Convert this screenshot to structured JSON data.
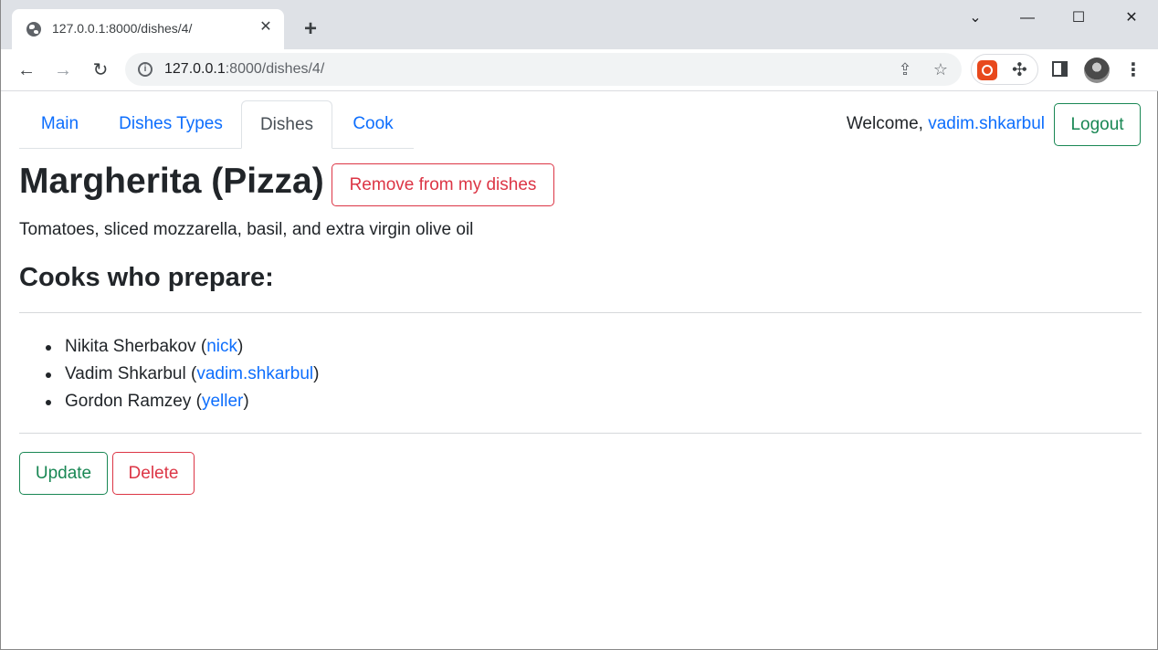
{
  "browser": {
    "tab_title": "127.0.0.1:8000/dishes/4/",
    "url_host": "127.0.0.1",
    "url_path": ":8000/dishes/4/"
  },
  "nav": {
    "tabs": [
      {
        "label": "Main"
      },
      {
        "label": "Dishes Types"
      },
      {
        "label": "Dishes"
      },
      {
        "label": "Cook"
      }
    ],
    "active_tab": "Dishes",
    "welcome_text": "Welcome,",
    "username": "vadim.shkarbul",
    "logout_label": "Logout"
  },
  "dish": {
    "title": "Margherita (Pizza)",
    "remove_label": "Remove from my dishes",
    "description": "Tomatoes, sliced mozzarella, basil, and extra virgin olive oil"
  },
  "cooks": {
    "heading": "Cooks who prepare:",
    "items": [
      {
        "name": "Nikita Sherbakov",
        "username": "nick"
      },
      {
        "name": "Vadim Shkarbul",
        "username": "vadim.shkarbul"
      },
      {
        "name": "Gordon Ramzey",
        "username": "yeller"
      }
    ]
  },
  "actions": {
    "update_label": "Update",
    "delete_label": "Delete"
  },
  "colors": {
    "link": "#0d6efd",
    "success": "#198754",
    "danger": "#dc3545",
    "text": "#212529"
  }
}
